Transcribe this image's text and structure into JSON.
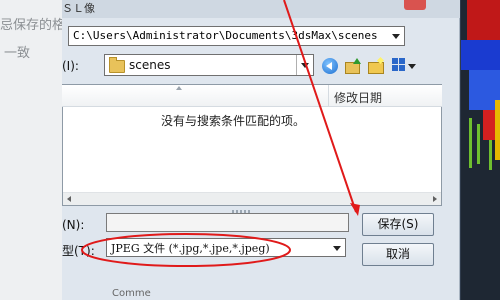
{
  "background_panel": {
    "line1": "忌保存的格",
    "line2": "一致"
  },
  "dialog": {
    "title_fragment": "ＳＬ像",
    "path": "C:\\Users\\Administrator\\Documents\\3dsMax\\scenes",
    "save_in": {
      "label": "(I):",
      "folder": "scenes"
    },
    "toolbar_icons": [
      "back-icon",
      "up-folder-icon",
      "new-folder-icon",
      "view-menu-icon"
    ],
    "file_list": {
      "column_date": "修改日期",
      "empty_message": "没有与搜索条件匹配的项。"
    },
    "filename": {
      "label": "(N):",
      "value": ""
    },
    "file_type": {
      "label": "型(T):",
      "value": "JPEG 文件 (*.jpg,*.jpe,*.jpeg)"
    },
    "save_button": "保存(S)",
    "cancel_button": "取消",
    "bottom_fragment": "Comme"
  },
  "annotations": {
    "arrow_color": "#e01a1a",
    "ellipse_color": "#e01a1a"
  }
}
